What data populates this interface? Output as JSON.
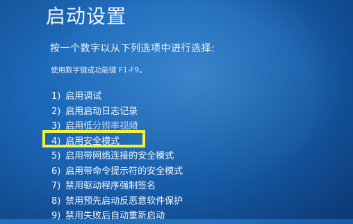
{
  "screen": {
    "title": "启动设置",
    "subtitle": "按一个数字以从下列选项中进行选择:",
    "hint": "使用数字键或功能键 F1-F9。"
  },
  "options": [
    {
      "num": "1)",
      "label": "启用调试"
    },
    {
      "num": "2)",
      "label": "启用启动日志记录"
    },
    {
      "num": "3)",
      "label": "启用低分辨率视频"
    },
    {
      "num": "4)",
      "label": "启用安全模式"
    },
    {
      "num": "5)",
      "label": "启用带网络连接的安全模式"
    },
    {
      "num": "6)",
      "label": "启用带命令提示符的安全模式"
    },
    {
      "num": "7)",
      "label": "禁用驱动程序强制签名"
    },
    {
      "num": "8)",
      "label": "禁用预先启动反恶意软件保护"
    },
    {
      "num": "9)",
      "label": "禁用失败后自动重新启动"
    }
  ],
  "highlighted_option": "4)",
  "colors": {
    "background": "#1b66b7",
    "text": "#ffffff",
    "highlight_box": "#f1f33a"
  }
}
